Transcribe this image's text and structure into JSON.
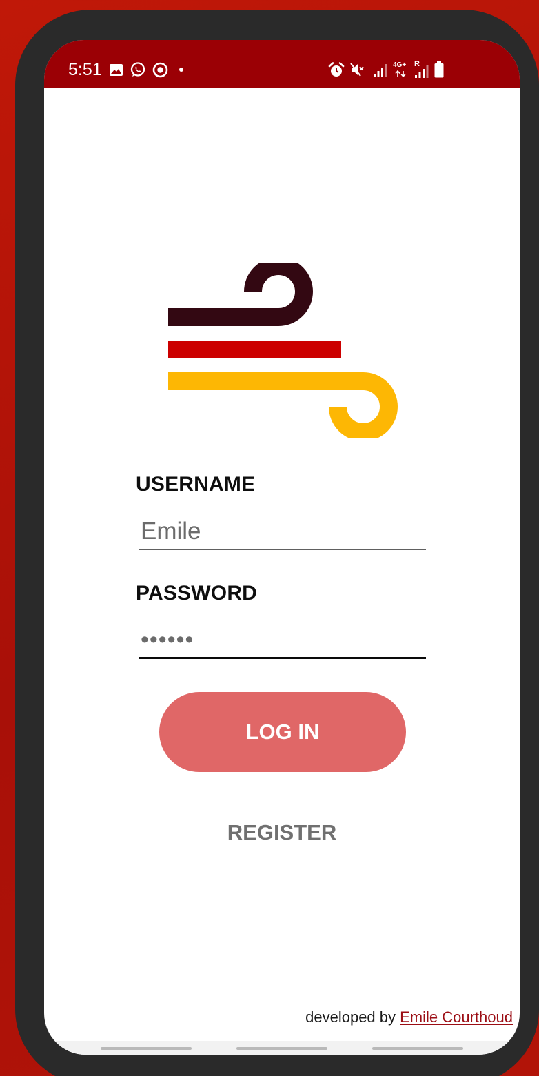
{
  "status_bar": {
    "time": "5:51",
    "left_icons": [
      "gallery-icon",
      "whatsapp-icon",
      "media-icon",
      "dot-icon"
    ],
    "right_icons": [
      "alarm-icon",
      "mute-icon",
      "signal-icon",
      "network-4g-icon",
      "roaming-signal-icon",
      "battery-icon"
    ],
    "network_label": "4G+",
    "roaming_label": "R"
  },
  "logo": {
    "icon": "wind-logo-icon",
    "colors": {
      "top": "#330812",
      "middle": "#cc0000",
      "bottom": "#fdb704"
    }
  },
  "form": {
    "username_label": "USERNAME",
    "username_value": "Emile",
    "password_label": "PASSWORD",
    "password_value": "••••••",
    "login_label": "LOG IN",
    "register_label": "REGISTER"
  },
  "footer": {
    "prefix": "developed by ",
    "author": "Emile Courthoud"
  },
  "colors": {
    "status_bar": "#9b0005",
    "accent": "#e06767",
    "background": "#b21408",
    "link": "#9b0d14"
  }
}
